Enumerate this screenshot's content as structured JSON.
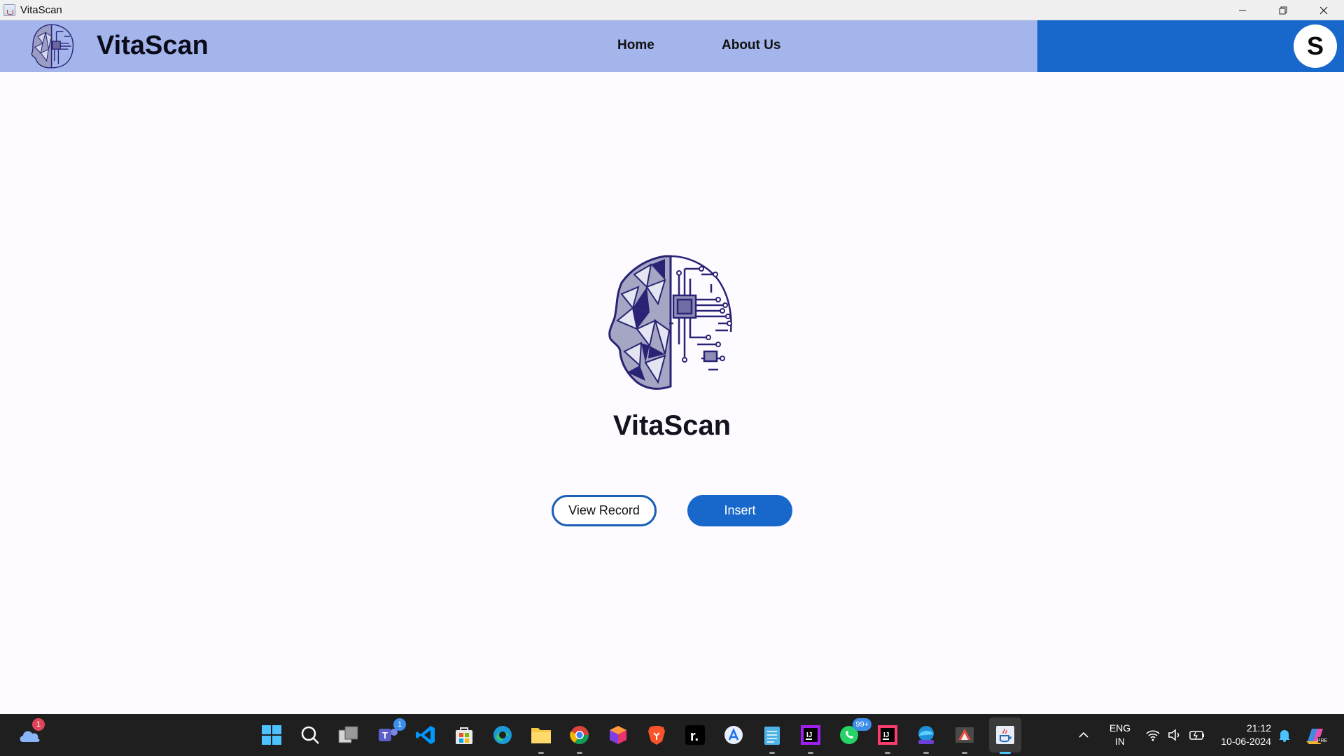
{
  "window": {
    "title": "VitaScan",
    "controls": [
      "minimize",
      "restore",
      "close"
    ]
  },
  "header": {
    "brand": "VitaScan",
    "nav": [
      "Home",
      "About Us"
    ],
    "avatar_letter": "S",
    "colors": {
      "left_bg": "#a3b5eb",
      "right_bg": "#1868cc"
    }
  },
  "main": {
    "title": "VitaScan",
    "buttons": {
      "view_record": "View Record",
      "insert": "Insert"
    },
    "accent": "#1868cc"
  },
  "taskbar": {
    "weather_badge": "1",
    "teams_badge": "1",
    "whatsapp_badge": "99+",
    "apps": [
      "start-icon",
      "search-icon",
      "task-view-icon",
      "teams-icon",
      "vscode-icon",
      "store-icon",
      "edge-icon",
      "file-explorer-icon",
      "chrome-icon",
      "cube-app-icon",
      "brave-icon",
      "replit-icon",
      "app-store-icon",
      "notepad-icon",
      "jetbrains-icon",
      "whatsapp-icon",
      "intellij-icon",
      "edge-dev-icon",
      "ide-app-icon",
      "java-app-icon"
    ],
    "lang_line1": "ENG",
    "lang_line2": "IN",
    "time": "21:12",
    "date": "10-06-2024"
  }
}
